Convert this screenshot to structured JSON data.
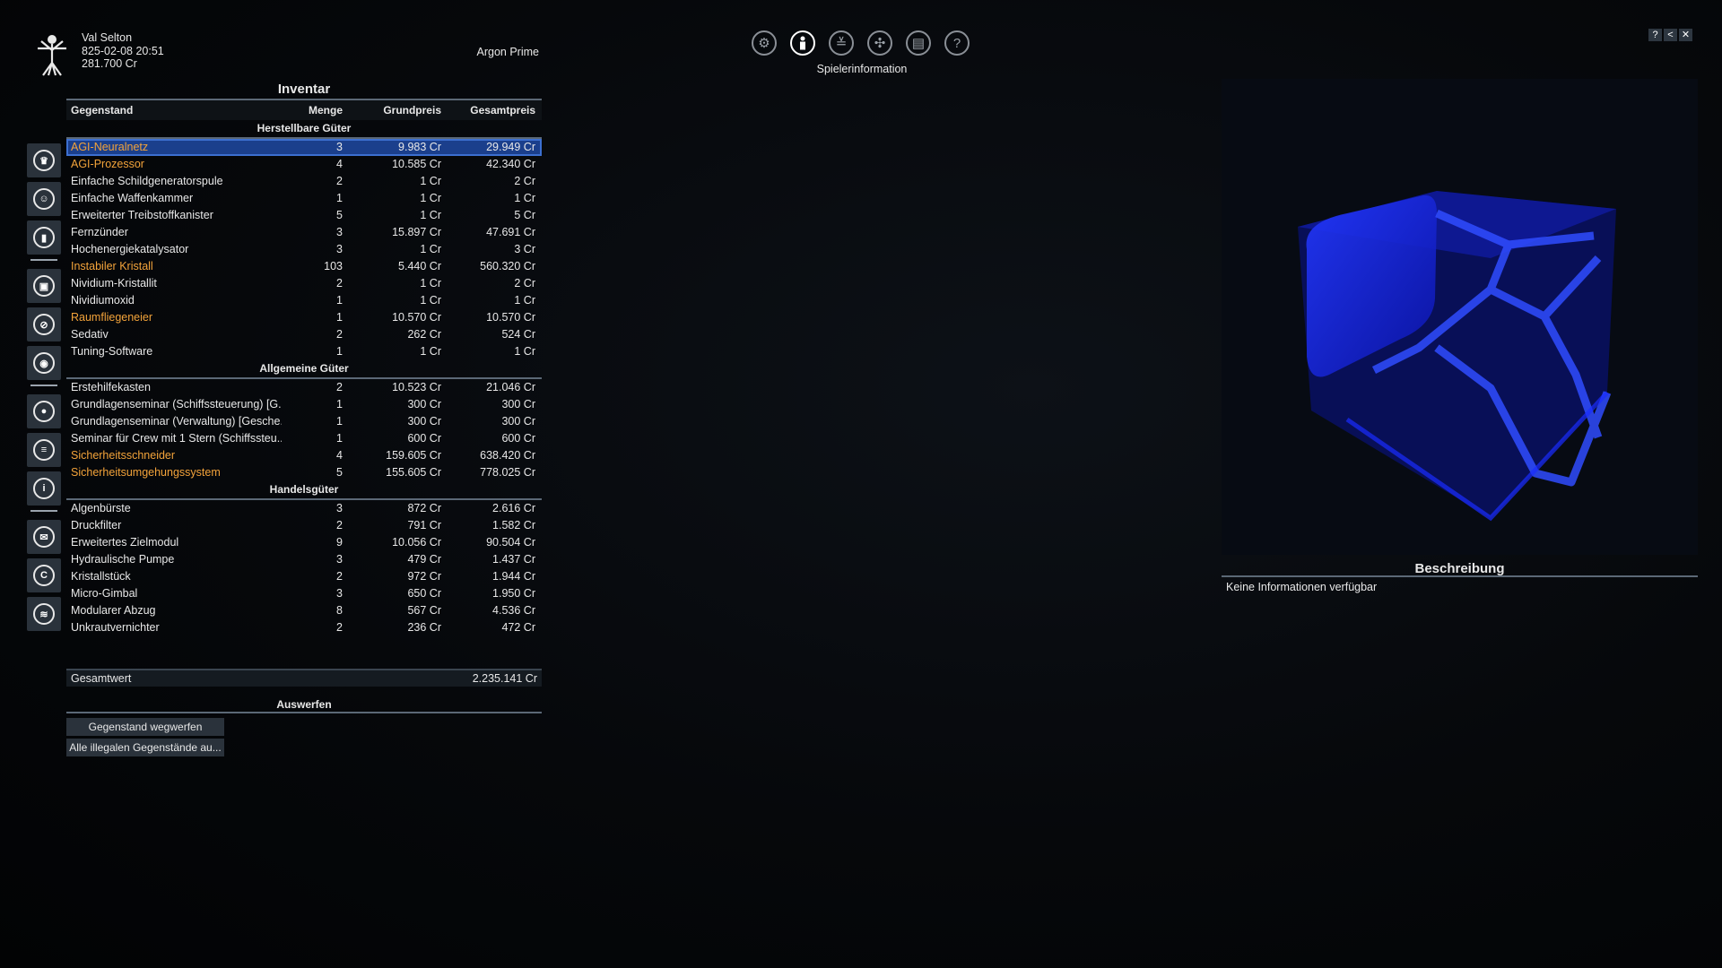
{
  "player": {
    "name": "Val Selton",
    "datetime": "825-02-08 20:51",
    "credits": "281.700 Cr",
    "location": "Argon Prime"
  },
  "topnav": {
    "icons": [
      "settings-icon",
      "player-info-icon",
      "empire-icon",
      "map-icon",
      "encyclopedia-icon",
      "help-icon"
    ],
    "active_label": "Spielerinformation"
  },
  "window_controls": [
    "?",
    "<",
    "✕"
  ],
  "sidebar": {
    "groups": [
      [
        "crown-icon",
        "people-icon",
        "stats-icon"
      ],
      [
        "station-icon",
        "ship-icon",
        "inventory-icon"
      ],
      [
        "globe-icon",
        "list-icon",
        "info-icon"
      ],
      [
        "mail-icon",
        "credits-icon",
        "logbook-icon"
      ]
    ]
  },
  "inventory": {
    "title": "Inventar",
    "columns": {
      "item": "Gegenstand",
      "qty": "Menge",
      "base": "Grundpreis",
      "total": "Gesamtpreis"
    },
    "sections": [
      {
        "title": "Herstellbare Güter",
        "rows": [
          {
            "name": "AGI-Neuralnetz",
            "qty": "3",
            "base": "9.983 Cr",
            "total": "29.949 Cr",
            "illegal": true,
            "selected": true
          },
          {
            "name": "AGI-Prozessor",
            "qty": "4",
            "base": "10.585 Cr",
            "total": "42.340 Cr",
            "illegal": true
          },
          {
            "name": "Einfache Schildgeneratorspule",
            "qty": "2",
            "base": "1 Cr",
            "total": "2 Cr"
          },
          {
            "name": "Einfache Waffenkammer",
            "qty": "1",
            "base": "1 Cr",
            "total": "1 Cr"
          },
          {
            "name": "Erweiterter Treibstoffkanister",
            "qty": "5",
            "base": "1 Cr",
            "total": "5 Cr"
          },
          {
            "name": "Fernzünder",
            "qty": "3",
            "base": "15.897 Cr",
            "total": "47.691 Cr"
          },
          {
            "name": "Hochenergiekatalysator",
            "qty": "3",
            "base": "1 Cr",
            "total": "3 Cr"
          },
          {
            "name": "Instabiler Kristall",
            "qty": "103",
            "base": "5.440 Cr",
            "total": "560.320 Cr",
            "illegal": true
          },
          {
            "name": "Nividium-Kristallit",
            "qty": "2",
            "base": "1 Cr",
            "total": "2 Cr"
          },
          {
            "name": "Nividiumoxid",
            "qty": "1",
            "base": "1 Cr",
            "total": "1 Cr"
          },
          {
            "name": "Raumfliegeneier",
            "qty": "1",
            "base": "10.570 Cr",
            "total": "10.570 Cr",
            "illegal": true
          },
          {
            "name": "Sedativ",
            "qty": "2",
            "base": "262 Cr",
            "total": "524 Cr"
          },
          {
            "name": "Tuning-Software",
            "qty": "1",
            "base": "1 Cr",
            "total": "1 Cr"
          }
        ]
      },
      {
        "title": "Allgemeine Güter",
        "rows": [
          {
            "name": "Erstehilfekasten",
            "qty": "2",
            "base": "10.523 Cr",
            "total": "21.046 Cr"
          },
          {
            "name": "Grundlagenseminar (Schiffssteuerung) [G...",
            "qty": "1",
            "base": "300 Cr",
            "total": "300 Cr"
          },
          {
            "name": "Grundlagenseminar (Verwaltung) [Gesche...",
            "qty": "1",
            "base": "300 Cr",
            "total": "300 Cr"
          },
          {
            "name": "Seminar für Crew mit 1 Stern (Schiffssteu...",
            "qty": "1",
            "base": "600 Cr",
            "total": "600 Cr"
          },
          {
            "name": "Sicherheitsschneider",
            "qty": "4",
            "base": "159.605 Cr",
            "total": "638.420 Cr",
            "illegal": true
          },
          {
            "name": "Sicherheitsumgehungssystem",
            "qty": "5",
            "base": "155.605 Cr",
            "total": "778.025 Cr",
            "illegal": true
          }
        ]
      },
      {
        "title": "Handelsgüter",
        "rows": [
          {
            "name": "Algenbürste",
            "qty": "3",
            "base": "872 Cr",
            "total": "2.616 Cr"
          },
          {
            "name": "Druckfilter",
            "qty": "2",
            "base": "791 Cr",
            "total": "1.582 Cr"
          },
          {
            "name": "Erweitertes Zielmodul",
            "qty": "9",
            "base": "10.056 Cr",
            "total": "90.504 Cr"
          },
          {
            "name": "Hydraulische Pumpe",
            "qty": "3",
            "base": "479 Cr",
            "total": "1.437 Cr"
          },
          {
            "name": "Kristallstück",
            "qty": "2",
            "base": "972 Cr",
            "total": "1.944 Cr"
          },
          {
            "name": "Micro-Gimbal",
            "qty": "3",
            "base": "650 Cr",
            "total": "1.950 Cr"
          },
          {
            "name": "Modularer Abzug",
            "qty": "8",
            "base": "567 Cr",
            "total": "4.536 Cr"
          },
          {
            "name": "Unkrautvernichter",
            "qty": "2",
            "base": "236 Cr",
            "total": "472 Cr"
          }
        ]
      }
    ],
    "total_label": "Gesamtwert",
    "total_value": "2.235.141 Cr",
    "eject_title": "Auswerfen",
    "eject_buttons": [
      "Gegenstand wegwerfen",
      "Alle illegalen Gegenstände au..."
    ]
  },
  "description": {
    "title": "Beschreibung",
    "text": "Keine Informationen verfügbar"
  },
  "colors": {
    "illegal": "#f3a33a",
    "selected_row": "#1b3f8c",
    "panel": "#2a323b",
    "preview_blue": "#1a2cff"
  }
}
